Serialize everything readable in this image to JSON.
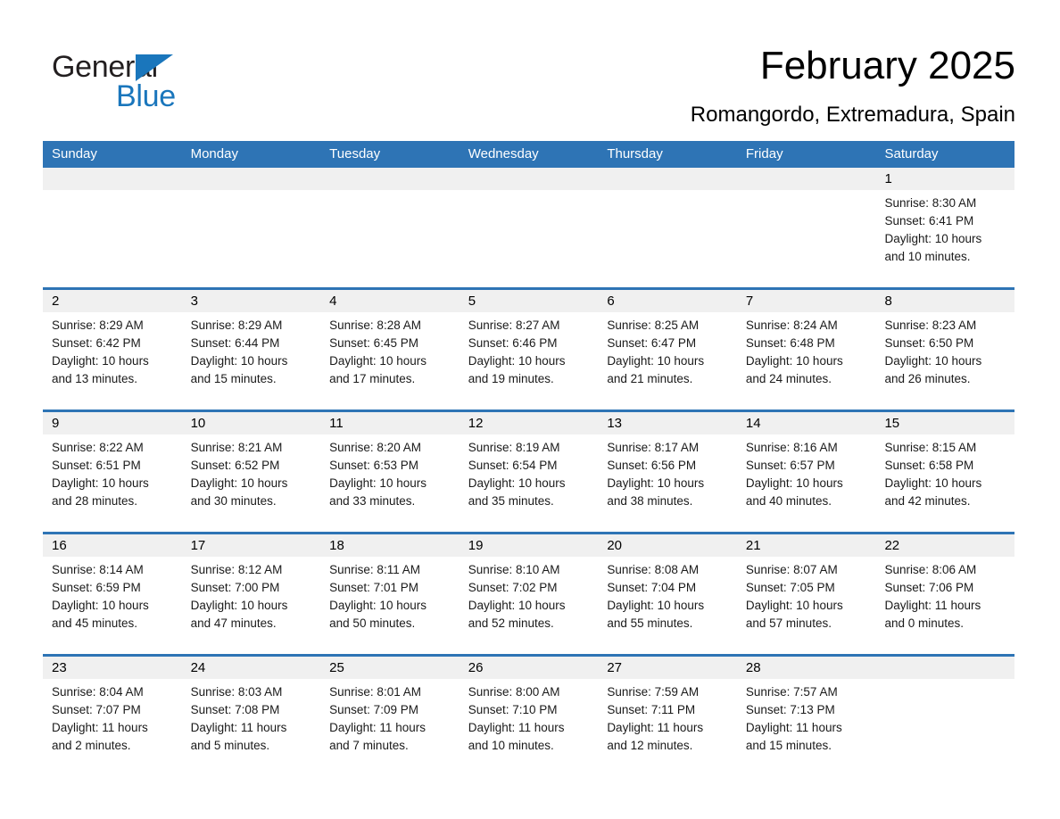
{
  "logo": {
    "word_one": "General",
    "word_two": "Blue",
    "accent_color": "#1a76bc",
    "triangle_icon": "triangle-icon"
  },
  "header": {
    "month_title": "February 2025",
    "location": "Romangordo, Extremadura, Spain",
    "header_blue": "#2e74b5"
  },
  "calendar": {
    "weekday_headers": [
      "Sunday",
      "Monday",
      "Tuesday",
      "Wednesday",
      "Thursday",
      "Friday",
      "Saturday"
    ],
    "weeks": [
      [
        {
          "date": "",
          "sunrise": "",
          "sunset": "",
          "daylight_line1": "",
          "daylight_line2": ""
        },
        {
          "date": "",
          "sunrise": "",
          "sunset": "",
          "daylight_line1": "",
          "daylight_line2": ""
        },
        {
          "date": "",
          "sunrise": "",
          "sunset": "",
          "daylight_line1": "",
          "daylight_line2": ""
        },
        {
          "date": "",
          "sunrise": "",
          "sunset": "",
          "daylight_line1": "",
          "daylight_line2": ""
        },
        {
          "date": "",
          "sunrise": "",
          "sunset": "",
          "daylight_line1": "",
          "daylight_line2": ""
        },
        {
          "date": "",
          "sunrise": "",
          "sunset": "",
          "daylight_line1": "",
          "daylight_line2": ""
        },
        {
          "date": "1",
          "sunrise": "Sunrise: 8:30 AM",
          "sunset": "Sunset: 6:41 PM",
          "daylight_line1": "Daylight: 10 hours",
          "daylight_line2": "and 10 minutes."
        }
      ],
      [
        {
          "date": "2",
          "sunrise": "Sunrise: 8:29 AM",
          "sunset": "Sunset: 6:42 PM",
          "daylight_line1": "Daylight: 10 hours",
          "daylight_line2": "and 13 minutes."
        },
        {
          "date": "3",
          "sunrise": "Sunrise: 8:29 AM",
          "sunset": "Sunset: 6:44 PM",
          "daylight_line1": "Daylight: 10 hours",
          "daylight_line2": "and 15 minutes."
        },
        {
          "date": "4",
          "sunrise": "Sunrise: 8:28 AM",
          "sunset": "Sunset: 6:45 PM",
          "daylight_line1": "Daylight: 10 hours",
          "daylight_line2": "and 17 minutes."
        },
        {
          "date": "5",
          "sunrise": "Sunrise: 8:27 AM",
          "sunset": "Sunset: 6:46 PM",
          "daylight_line1": "Daylight: 10 hours",
          "daylight_line2": "and 19 minutes."
        },
        {
          "date": "6",
          "sunrise": "Sunrise: 8:25 AM",
          "sunset": "Sunset: 6:47 PM",
          "daylight_line1": "Daylight: 10 hours",
          "daylight_line2": "and 21 minutes."
        },
        {
          "date": "7",
          "sunrise": "Sunrise: 8:24 AM",
          "sunset": "Sunset: 6:48 PM",
          "daylight_line1": "Daylight: 10 hours",
          "daylight_line2": "and 24 minutes."
        },
        {
          "date": "8",
          "sunrise": "Sunrise: 8:23 AM",
          "sunset": "Sunset: 6:50 PM",
          "daylight_line1": "Daylight: 10 hours",
          "daylight_line2": "and 26 minutes."
        }
      ],
      [
        {
          "date": "9",
          "sunrise": "Sunrise: 8:22 AM",
          "sunset": "Sunset: 6:51 PM",
          "daylight_line1": "Daylight: 10 hours",
          "daylight_line2": "and 28 minutes."
        },
        {
          "date": "10",
          "sunrise": "Sunrise: 8:21 AM",
          "sunset": "Sunset: 6:52 PM",
          "daylight_line1": "Daylight: 10 hours",
          "daylight_line2": "and 30 minutes."
        },
        {
          "date": "11",
          "sunrise": "Sunrise: 8:20 AM",
          "sunset": "Sunset: 6:53 PM",
          "daylight_line1": "Daylight: 10 hours",
          "daylight_line2": "and 33 minutes."
        },
        {
          "date": "12",
          "sunrise": "Sunrise: 8:19 AM",
          "sunset": "Sunset: 6:54 PM",
          "daylight_line1": "Daylight: 10 hours",
          "daylight_line2": "and 35 minutes."
        },
        {
          "date": "13",
          "sunrise": "Sunrise: 8:17 AM",
          "sunset": "Sunset: 6:56 PM",
          "daylight_line1": "Daylight: 10 hours",
          "daylight_line2": "and 38 minutes."
        },
        {
          "date": "14",
          "sunrise": "Sunrise: 8:16 AM",
          "sunset": "Sunset: 6:57 PM",
          "daylight_line1": "Daylight: 10 hours",
          "daylight_line2": "and 40 minutes."
        },
        {
          "date": "15",
          "sunrise": "Sunrise: 8:15 AM",
          "sunset": "Sunset: 6:58 PM",
          "daylight_line1": "Daylight: 10 hours",
          "daylight_line2": "and 42 minutes."
        }
      ],
      [
        {
          "date": "16",
          "sunrise": "Sunrise: 8:14 AM",
          "sunset": "Sunset: 6:59 PM",
          "daylight_line1": "Daylight: 10 hours",
          "daylight_line2": "and 45 minutes."
        },
        {
          "date": "17",
          "sunrise": "Sunrise: 8:12 AM",
          "sunset": "Sunset: 7:00 PM",
          "daylight_line1": "Daylight: 10 hours",
          "daylight_line2": "and 47 minutes."
        },
        {
          "date": "18",
          "sunrise": "Sunrise: 8:11 AM",
          "sunset": "Sunset: 7:01 PM",
          "daylight_line1": "Daylight: 10 hours",
          "daylight_line2": "and 50 minutes."
        },
        {
          "date": "19",
          "sunrise": "Sunrise: 8:10 AM",
          "sunset": "Sunset: 7:02 PM",
          "daylight_line1": "Daylight: 10 hours",
          "daylight_line2": "and 52 minutes."
        },
        {
          "date": "20",
          "sunrise": "Sunrise: 8:08 AM",
          "sunset": "Sunset: 7:04 PM",
          "daylight_line1": "Daylight: 10 hours",
          "daylight_line2": "and 55 minutes."
        },
        {
          "date": "21",
          "sunrise": "Sunrise: 8:07 AM",
          "sunset": "Sunset: 7:05 PM",
          "daylight_line1": "Daylight: 10 hours",
          "daylight_line2": "and 57 minutes."
        },
        {
          "date": "22",
          "sunrise": "Sunrise: 8:06 AM",
          "sunset": "Sunset: 7:06 PM",
          "daylight_line1": "Daylight: 11 hours",
          "daylight_line2": "and 0 minutes."
        }
      ],
      [
        {
          "date": "23",
          "sunrise": "Sunrise: 8:04 AM",
          "sunset": "Sunset: 7:07 PM",
          "daylight_line1": "Daylight: 11 hours",
          "daylight_line2": "and 2 minutes."
        },
        {
          "date": "24",
          "sunrise": "Sunrise: 8:03 AM",
          "sunset": "Sunset: 7:08 PM",
          "daylight_line1": "Daylight: 11 hours",
          "daylight_line2": "and 5 minutes."
        },
        {
          "date": "25",
          "sunrise": "Sunrise: 8:01 AM",
          "sunset": "Sunset: 7:09 PM",
          "daylight_line1": "Daylight: 11 hours",
          "daylight_line2": "and 7 minutes."
        },
        {
          "date": "26",
          "sunrise": "Sunrise: 8:00 AM",
          "sunset": "Sunset: 7:10 PM",
          "daylight_line1": "Daylight: 11 hours",
          "daylight_line2": "and 10 minutes."
        },
        {
          "date": "27",
          "sunrise": "Sunrise: 7:59 AM",
          "sunset": "Sunset: 7:11 PM",
          "daylight_line1": "Daylight: 11 hours",
          "daylight_line2": "and 12 minutes."
        },
        {
          "date": "28",
          "sunrise": "Sunrise: 7:57 AM",
          "sunset": "Sunset: 7:13 PM",
          "daylight_line1": "Daylight: 11 hours",
          "daylight_line2": "and 15 minutes."
        },
        {
          "date": "",
          "sunrise": "",
          "sunset": "",
          "daylight_line1": "",
          "daylight_line2": ""
        }
      ]
    ]
  }
}
